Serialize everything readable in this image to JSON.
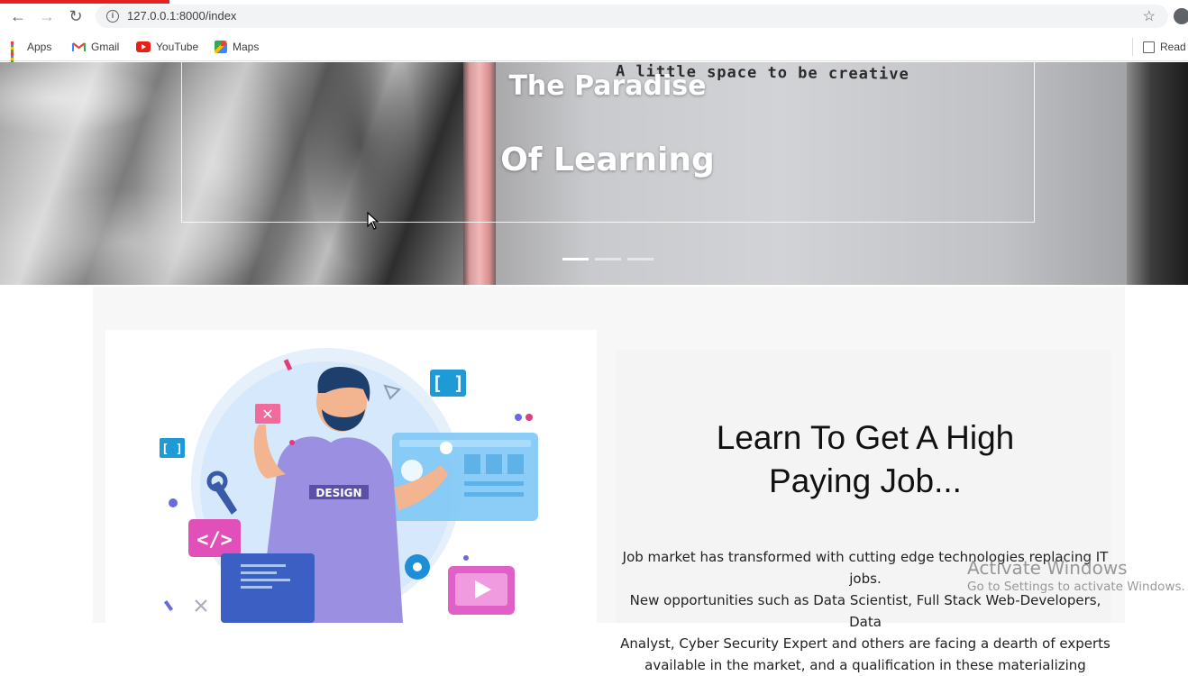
{
  "browser": {
    "url": "127.0.0.1:8000/index",
    "bookmarks": [
      {
        "label": "Apps",
        "icon": "apps-grid-icon"
      },
      {
        "label": "Gmail",
        "icon": "gmail-icon"
      },
      {
        "label": "YouTube",
        "icon": "youtube-icon"
      },
      {
        "label": "Maps",
        "icon": "maps-icon"
      }
    ],
    "reading_list_label": "Read"
  },
  "hero": {
    "background_text": "A little space to be creative",
    "title_line1": "The Paradise",
    "title_line2": "Of Learning",
    "slides_total": 3,
    "active_slide": 1
  },
  "feature": {
    "illustration_badge": "DESIGN",
    "headline_line1": "Learn To Get A High",
    "headline_line2": "Paying Job...",
    "paragraph_lines": [
      "Job market has transformed with cutting edge technologies replacing IT jobs.",
      "New opportunities such as Data Scientist, Full Stack Web-Developers, Data",
      "Analyst, Cyber Security Expert and others are facing a dearth of experts",
      "available in the market, and a qualification in these materializing"
    ]
  },
  "os_overlay": {
    "activate_title": "Activate Windows",
    "activate_subtitle": "Go to Settings to activate Windows."
  },
  "colors": {
    "load_bar": "#e52222",
    "hero_text": "#ffffff",
    "headline": "#111111"
  }
}
